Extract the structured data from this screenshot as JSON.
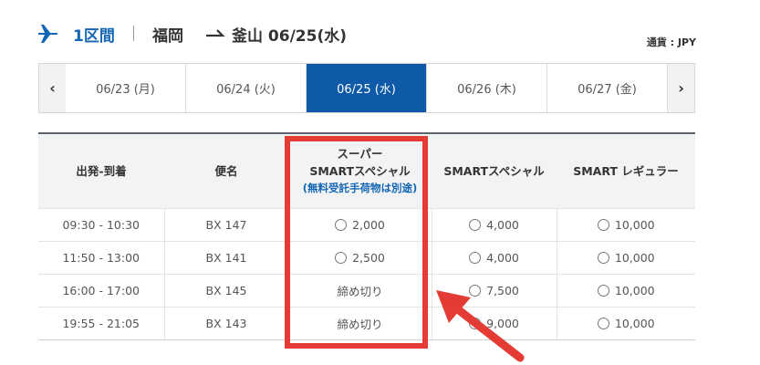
{
  "header": {
    "segment": "1区間",
    "origin": "福岡",
    "destination": "釜山 06/25(水)",
    "currency": "通貨 : JPY"
  },
  "date_nav": {
    "prev": "‹",
    "next": "›",
    "tabs": [
      {
        "label": "06/23 (月)",
        "active": false
      },
      {
        "label": "06/24 (火)",
        "active": false
      },
      {
        "label": "06/25 (水)",
        "active": true
      },
      {
        "label": "06/26 (木)",
        "active": false
      },
      {
        "label": "06/27 (金)",
        "active": false
      }
    ]
  },
  "table": {
    "headers": {
      "time": "出発-到着",
      "flight": "便名",
      "super_line1": "スーパー",
      "super_line2": "SMARTスペシャル",
      "super_note": "(無料受託手荷物は別途)",
      "special": "SMARTスペシャル",
      "regular": "SMART レギュラー"
    },
    "rows": [
      {
        "time": "09:30 - 10:30",
        "flight": "BX 147",
        "super": "2,000",
        "super_closed": false,
        "special": "4,000",
        "regular": "10,000"
      },
      {
        "time": "11:50 - 13:00",
        "flight": "BX 141",
        "super": "2,500",
        "super_closed": false,
        "special": "4,000",
        "regular": "10,000"
      },
      {
        "time": "16:00 - 17:00",
        "flight": "BX 145",
        "super": "締め切り",
        "super_closed": true,
        "special": "7,500",
        "regular": "10,000"
      },
      {
        "time": "19:55 - 21:05",
        "flight": "BX 143",
        "super": "締め切り",
        "super_closed": true,
        "special": "9,000",
        "regular": "10,000"
      }
    ]
  },
  "colors": {
    "brand_blue": "#1466b4",
    "active_tab": "#0e5aa8",
    "annotation_red": "#e53b35"
  },
  "icons": [
    "plane-icon",
    "right-arrow-icon",
    "chevron-left-icon",
    "chevron-right-icon",
    "radio-icon"
  ]
}
